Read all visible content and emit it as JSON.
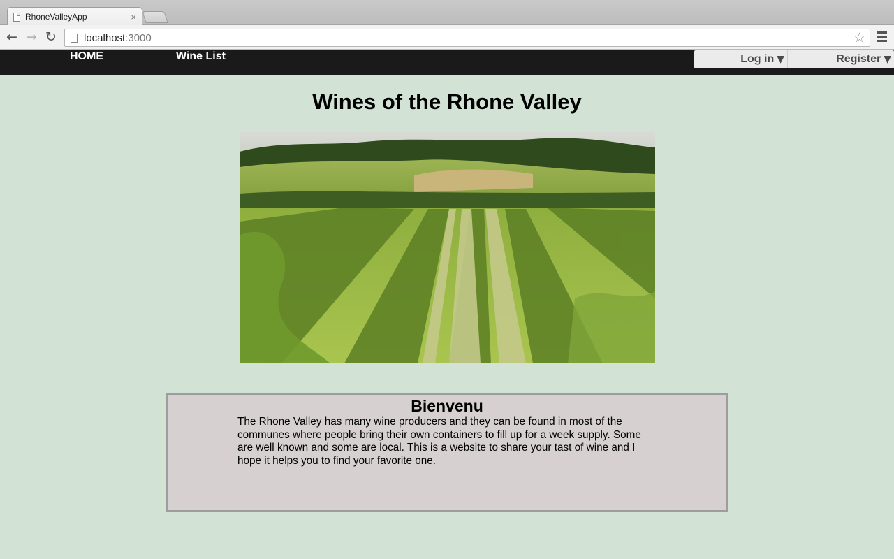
{
  "browser": {
    "tab_title": "RhoneValleyApp",
    "tab_close": "×",
    "url_host": "localhost",
    "url_port": ":3000",
    "star_glyph": "☆",
    "back_glyph": "←",
    "forward_glyph": "→",
    "reload_glyph": "↻"
  },
  "site_nav": {
    "home": "HOME",
    "wine_list": "Wine List",
    "login": "Log in",
    "register": "Register",
    "dropdown_glyph": "▼"
  },
  "main": {
    "title": "Wines of the Rhone Valley",
    "hero_image": "vineyard-photo",
    "welcome": {
      "heading": "Bienvenu",
      "body": "The Rhone Valley has many wine producers and they can be found in most of the communes where people bring their own containers to fill up for a week supply. Some are well known and some are local. This is a website to share your tast of wine and I hope it helps you to find your favorite one."
    }
  },
  "colors": {
    "page_bg": "#d2e3d6",
    "nav_bg": "#1a1a1a",
    "panel_bg": "#d6d0d0",
    "panel_border": "#9d9d9d"
  }
}
